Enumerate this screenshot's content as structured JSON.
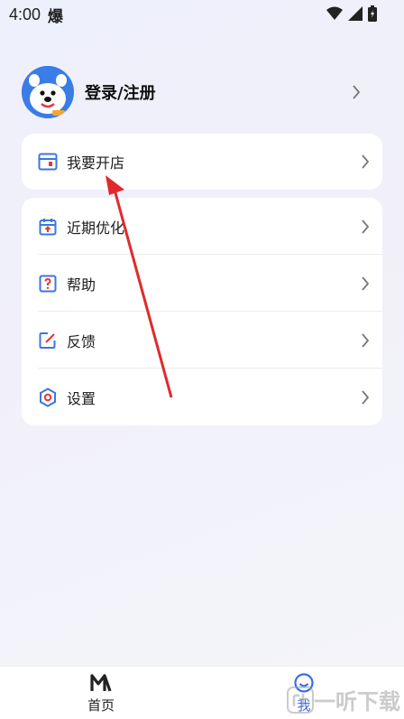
{
  "status_bar": {
    "time": "4:00",
    "app_glyph": "爆"
  },
  "profile": {
    "name": "登录/注册"
  },
  "menu_primary": [
    {
      "label": "我要开店",
      "icon": "storefront-icon"
    }
  ],
  "menu_secondary": [
    {
      "label": "近期优化",
      "icon": "calendar-icon"
    },
    {
      "label": "帮助",
      "icon": "help-icon"
    },
    {
      "label": "反馈",
      "icon": "edit-icon"
    },
    {
      "label": "设置",
      "icon": "settings-icon"
    }
  ],
  "bottom_nav": [
    {
      "label": "首页",
      "icon": "m-logo-icon",
      "active": false
    },
    {
      "label": "我",
      "icon": "smile-icon",
      "active": true
    }
  ],
  "watermark": {
    "text": "一听下载"
  },
  "colors": {
    "accent": "#3a6de6",
    "icon_blue": "#3b76e1",
    "icon_red": "#e4393c",
    "arrow": "#e02a2a"
  }
}
